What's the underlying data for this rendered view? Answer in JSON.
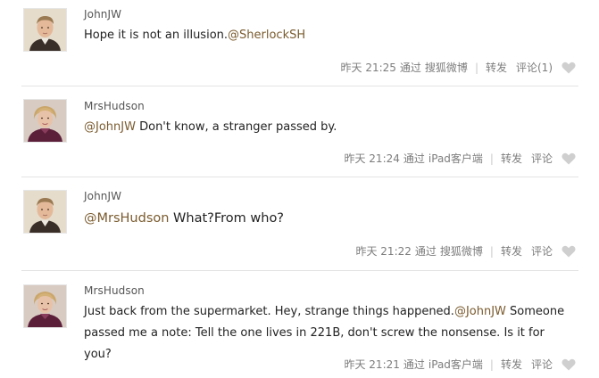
{
  "feed": {
    "posts": [
      {
        "username": "JohnJW",
        "avatar": "john-avatar",
        "text_before": "Hope it is not an illusion.",
        "mention": "@SherlockSH",
        "text_after": "",
        "time": "昨天 21:25",
        "via": "通过",
        "source": "搜狐微博",
        "repost": "转发",
        "comment": "评论(1)"
      },
      {
        "username": "MrsHudson",
        "avatar": "hudson-avatar",
        "mention": "@JohnJW",
        "text_after": " Don't know, a stranger passed by.",
        "time": "昨天 21:24",
        "via": "通过",
        "source": "iPad客户端",
        "repost": "转发",
        "comment": "评论"
      },
      {
        "username": "JohnJW",
        "avatar": "john-avatar",
        "mention": "@MrsHudson",
        "text_after": " What?From who?",
        "time": "昨天 21:22",
        "via": "通过",
        "source": "搜狐微博",
        "repost": "转发",
        "comment": "评论"
      },
      {
        "username": "MrsHudson",
        "avatar": "hudson-avatar",
        "text_before": "Just back from the supermarket. Hey, strange things happened.",
        "mention": "@JohnJW",
        "text_after": " Someone",
        "line2": "passed me a note: Tell the one lives in 221B, don't screw the nonsense. Is it for you?",
        "time": "昨天 21:21",
        "via": "通过",
        "source": "iPad客户端",
        "repost": "转发",
        "comment": "评论"
      }
    ]
  },
  "colors": {
    "mention": "#7a5b2e",
    "meta": "#7d7d7d",
    "divider": "#e3e3e3"
  },
  "icons": {
    "like": "heart-icon"
  }
}
